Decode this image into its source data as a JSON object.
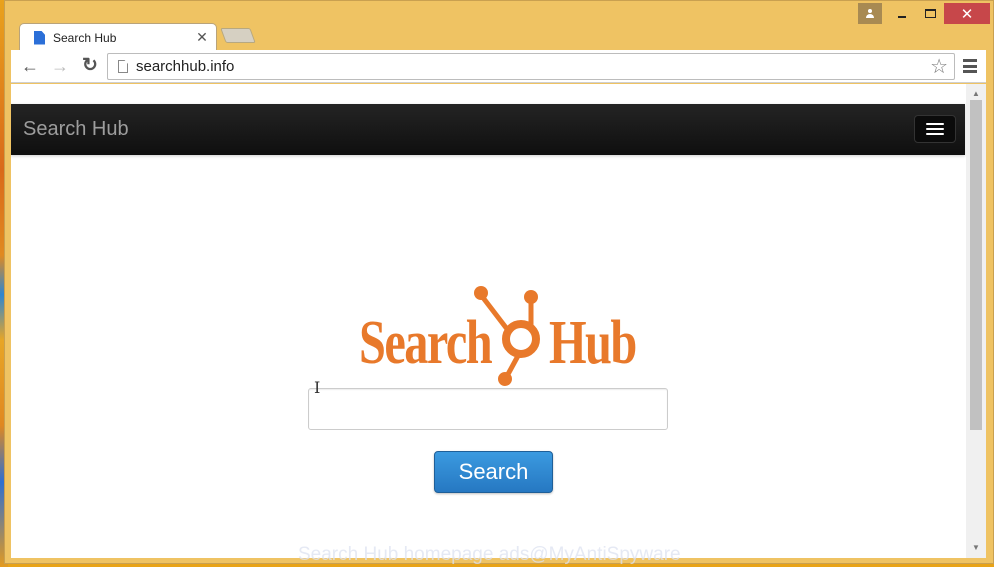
{
  "window": {
    "controls": {
      "user": "user-profile",
      "minimize": "minimize",
      "maximize": "maximize",
      "close": "✕"
    }
  },
  "tabs": [
    {
      "title": "Search Hub",
      "close": "✕",
      "active": true
    }
  ],
  "toolbar": {
    "back": "←",
    "forward": "→",
    "reload": "↻",
    "url": "searchhub.info",
    "star": "☆"
  },
  "page": {
    "navbar": {
      "brand": "Search Hub"
    },
    "logo": {
      "left_text": "Search",
      "right_text": "Hub",
      "color": "#e8792b"
    },
    "search": {
      "value": "",
      "placeholder": "",
      "button_label": "Search",
      "button_color": "#2a86d0"
    },
    "cursor": "I"
  },
  "scrollbar": {
    "up": "▲",
    "down": "▼"
  },
  "watermark": "Search Hub homepage ads@MyAntiSpyware"
}
